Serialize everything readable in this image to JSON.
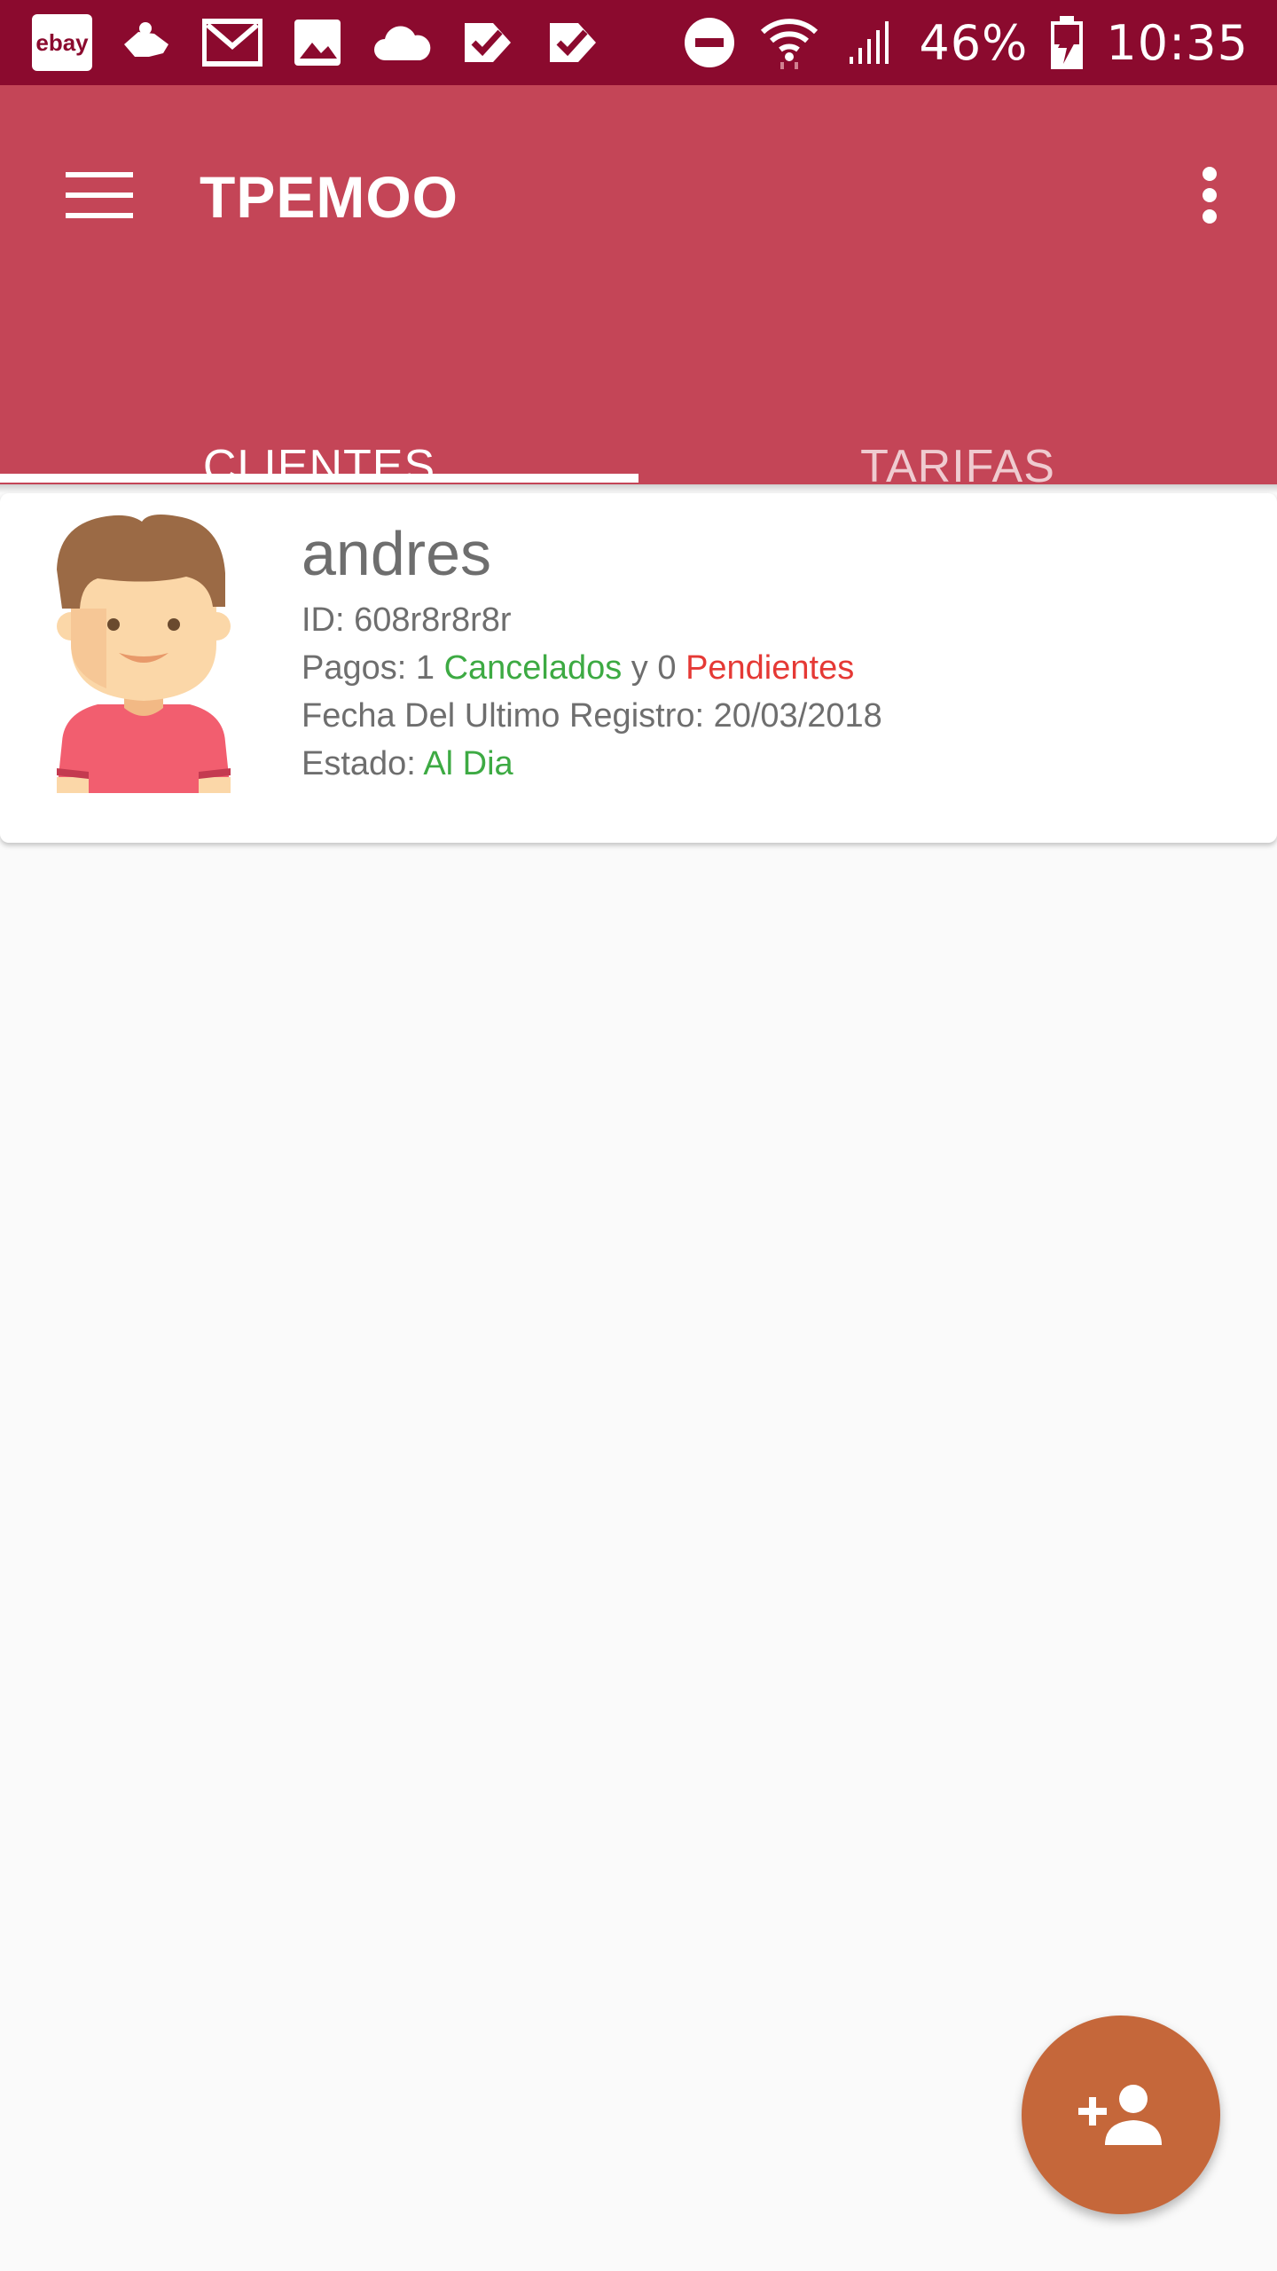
{
  "status_bar": {
    "notification_icons": [
      "ebay-icon",
      "delivery-icon",
      "gmail-icon",
      "image-icon",
      "cloud-icon",
      "check-task-icon",
      "check-task-icon"
    ],
    "ebay_label": "ebay",
    "battery": "46%",
    "time": "10:35"
  },
  "app_bar": {
    "title": "TPEMOO",
    "menu_icon": "menu-icon",
    "overflow_icon": "more-vert-icon"
  },
  "tabs": [
    {
      "label": "CLIENTES",
      "selected": true
    },
    {
      "label": "TARIFAS",
      "selected": false
    }
  ],
  "client": {
    "name": "andres",
    "id_line": "ID: 608r8r8r8r",
    "pagos_prefix": "Pagos: 1 ",
    "cancelados": "Cancelados",
    "pagos_mid": " y 0 ",
    "pendientes": "Pendientes",
    "fecha_line": "Fecha Del Ultimo Registro: 20/03/2018",
    "estado_prefix": "Estado: ",
    "estado_value": "Al Dia"
  },
  "fab": {
    "icon": "person-add-icon"
  },
  "colors": {
    "status_bar": "#8b0a2e",
    "app_bar": "#c44557",
    "fab": "#c5673a",
    "green": "#3daa43",
    "red": "#e53935"
  }
}
